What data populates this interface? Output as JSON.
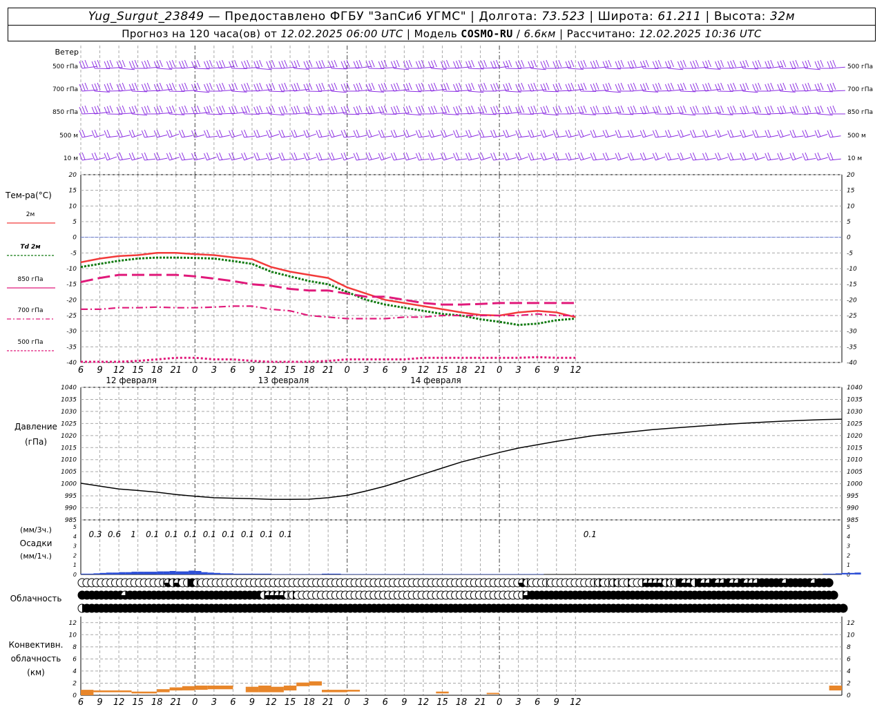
{
  "header": {
    "station": "Yug_Surgut_23849",
    "dash": "—",
    "provided": "Предоставлено ФГБУ \"ЗапСиб УГМС\"",
    "lon_label": "Долгота:",
    "lon": "73.523",
    "lat_label": "Широта:",
    "lat": "61.211",
    "alt_label": "Высота:",
    "alt": "32м",
    "forecast_label": "Прогноз на 120 часа(ов) от",
    "forecast_time": "12.02.2025 06:00 UTC",
    "model_label": "Модель",
    "model": "COSMO-RU",
    "resolution": "6.6км",
    "computed_label": "Рассчитано:",
    "computed_time": "12.02.2025 10:36 UTC",
    "sep": "|"
  },
  "time_axis": {
    "hours": [
      "6",
      "9",
      "12",
      "15",
      "18",
      "21",
      "0",
      "3",
      "6",
      "9",
      "12",
      "15",
      "18",
      "21",
      "0",
      "3",
      "6",
      "9",
      "12",
      "15",
      "18",
      "21",
      "0",
      "3",
      "6",
      "9",
      "12"
    ],
    "dates": [
      {
        "label": "12 февраля",
        "at_index": 2
      },
      {
        "label": "13 февраля",
        "at_index": 10
      },
      {
        "label": "14 февраля",
        "at_index": 18
      }
    ]
  },
  "wind_panel": {
    "title": "Ветер",
    "levels": [
      "500 гПа",
      "700 гПа",
      "850 гПа",
      "500 м",
      "10  м"
    ],
    "right_levels": [
      "500 гПа",
      "700 гПа",
      "850 гПа",
      "500 м",
      "10  м"
    ],
    "barb_color": "#8a2be2"
  },
  "colors": {
    "t2m": "#f23a3a",
    "td2m": "#117a11",
    "t850": "#e0197a",
    "t700": "#e0197a",
    "t500": "#e0197a",
    "zero_line": "#3050e0",
    "precip": "#2d4fd6",
    "convective": "#e8862a",
    "grid": "#a8a8a8"
  },
  "chart_data": [
    {
      "type": "line",
      "panel": "temperature",
      "title": "Тем-ра(°С)",
      "ylim": [
        -40,
        20
      ],
      "yticks": [
        "20",
        "15",
        "10",
        "5",
        "0",
        "-5",
        "-10",
        "-15",
        "-20",
        "-25",
        "-30",
        "-35",
        "-40"
      ],
      "x_hours_from_start": [
        0,
        3,
        6,
        9,
        12,
        15,
        18,
        21,
        24,
        27,
        30,
        33,
        36,
        39,
        42,
        45,
        48,
        51,
        54,
        57,
        60,
        63,
        66,
        69,
        72,
        75,
        78
      ],
      "series": [
        {
          "name": "2м",
          "values": [
            -8,
            -6.8,
            -6,
            -5.7,
            -5,
            -5,
            -5.4,
            -5.7,
            -6.4,
            -7,
            -9.5,
            -11,
            -12,
            -13,
            -16,
            -18,
            -20,
            -21,
            -22,
            -23,
            -24,
            -24.8,
            -25,
            -24,
            -23.5,
            -24,
            -25.5
          ]
        },
        {
          "name": "Td 2м",
          "values": [
            -9.5,
            -8.5,
            -7.5,
            -6.8,
            -6.5,
            -6.5,
            -6.6,
            -6.8,
            -7.6,
            -8.5,
            -11,
            -12.5,
            -14,
            -15,
            -17.5,
            -20,
            -21.5,
            -22.5,
            -23.5,
            -24.5,
            -25,
            -26.2,
            -27,
            -28,
            -27.6,
            -26.5,
            -26
          ]
        },
        {
          "name": "850 гПа",
          "values": [
            -14.3,
            -13,
            -12,
            -12,
            -12,
            -12,
            -12.5,
            -13.2,
            -14,
            -15,
            -15.5,
            -16.5,
            -17,
            -17,
            -18,
            -19,
            -19,
            -20,
            -21,
            -21.5,
            -21.5,
            -21.3,
            -21,
            -21,
            -21,
            -21,
            -21
          ]
        },
        {
          "name": "700 гПа",
          "values": [
            -23,
            -23,
            -22.5,
            -22.5,
            -22.3,
            -22.5,
            -22.5,
            -22.3,
            -22,
            -22,
            -23,
            -23.5,
            -25,
            -25.5,
            -26,
            -26,
            -26,
            -25.5,
            -25.5,
            -25,
            -25,
            -25,
            -25,
            -25,
            -24.5,
            -25,
            -25
          ]
        },
        {
          "name": "500 гПа",
          "values": [
            -41,
            -40.5,
            -40,
            -39.5,
            -39,
            -38.5,
            -38.5,
            -39,
            -39,
            -39.5,
            -40,
            -41,
            -41,
            -39.5,
            -39,
            -39,
            -39,
            -39,
            -38.5,
            -38.5,
            -38.5,
            -38.5,
            -38.5,
            -38.5,
            -38.3,
            -38.5,
            -38.5
          ]
        }
      ]
    },
    {
      "type": "line",
      "panel": "pressure",
      "title": "Давление",
      "unit": "(гПа)",
      "ylim": [
        985,
        1040
      ],
      "yticks": [
        "1040",
        "1035",
        "1030",
        "1025",
        "1020",
        "1015",
        "1010",
        "1005",
        "1000",
        "995",
        "990",
        "985"
      ],
      "x_hours_from_start": [
        0,
        3,
        6,
        9,
        12,
        15,
        18,
        21,
        24,
        27,
        30,
        33,
        36,
        39,
        42,
        45,
        48,
        51,
        54,
        57,
        60,
        63,
        66,
        69,
        72,
        75,
        78,
        81,
        84,
        87,
        90,
        93,
        96,
        99,
        102,
        105,
        108,
        111,
        114,
        117,
        120
      ],
      "values": [
        1000.2,
        999,
        997.8,
        997.2,
        996.5,
        995.5,
        994.8,
        994.2,
        994,
        993.8,
        993.5,
        993.5,
        993.6,
        994.2,
        995.2,
        997,
        999,
        1001.5,
        1004,
        1006.5,
        1009,
        1011,
        1013,
        1014.8,
        1016.2,
        1017.6,
        1018.8,
        1020,
        1020.8,
        1021.6,
        1022.4,
        1023,
        1023.6,
        1024.2,
        1024.7,
        1025.2,
        1025.6,
        1026,
        1026.3,
        1026.6,
        1026.8
      ]
    },
    {
      "type": "bar",
      "panel": "precipitation",
      "title": "Осадки",
      "unit_3h": "(мм/3ч.)",
      "unit_1h": "(мм/1ч.)",
      "ylim": [
        0,
        5
      ],
      "yticks": [
        "5",
        "4",
        "3",
        "2",
        "1",
        "0"
      ],
      "sum_labels_3h": [
        "0.3",
        "0.6",
        "1",
        "0.1",
        "0.1",
        "0.1",
        "0.1",
        "0.1",
        "0.1",
        "0.1",
        "0.1",
        "0.1"
      ],
      "sum_label_indices": [
        0,
        1,
        2,
        3,
        4,
        5,
        6,
        7,
        8,
        9,
        10,
        26
      ],
      "hourly_values": [
        0.1,
        0.1,
        0.15,
        0.2,
        0.25,
        0.25,
        0.3,
        0.3,
        0.35,
        0.35,
        0.35,
        0.35,
        0.4,
        0.4,
        0.45,
        0.4,
        0.4,
        0.5,
        0.45,
        0.3,
        0.25,
        0.2,
        0.15,
        0.15,
        0.1,
        0.1,
        0.1,
        0.1,
        0.1,
        0.1,
        0.05,
        0.05,
        0.05,
        0.05,
        0.05,
        0.05,
        0.05,
        0.05,
        0.1,
        0.1,
        0.1,
        0.05,
        0.05,
        0.05,
        0.05,
        0.05,
        0.05,
        0.05,
        0.05,
        0.05,
        0.05,
        0.05,
        0.05,
        0.05,
        0.05,
        0.05,
        0.05,
        0.05,
        0.05,
        0.05,
        0.05,
        0.05,
        0.05,
        0.05,
        0.05,
        0.05,
        0.05,
        0.05,
        0.05,
        0.05,
        0.05,
        0.05,
        0.05,
        0,
        0,
        0,
        0,
        0,
        0,
        0,
        0,
        0,
        0,
        0,
        0,
        0,
        0,
        0,
        0,
        0,
        0,
        0,
        0,
        0,
        0,
        0,
        0,
        0,
        0,
        0,
        0,
        0,
        0,
        0,
        0,
        0,
        0,
        0,
        0,
        0,
        0,
        0,
        0,
        0,
        0,
        0,
        0,
        0.1,
        0.1,
        0.15,
        0.2,
        0.2,
        0.25
      ]
    },
    {
      "type": "table",
      "panel": "cloudiness",
      "title": "Облачность",
      "rows": [
        [
          0,
          0,
          0,
          0,
          0,
          0,
          0,
          0,
          0,
          0,
          0,
          0,
          0,
          0,
          0,
          0,
          0,
          1,
          3,
          2,
          3,
          0,
          2,
          4,
          1,
          0,
          0,
          0,
          0,
          0,
          0,
          0,
          0,
          0,
          0,
          0,
          0,
          0,
          0,
          0,
          0,
          0,
          0,
          0,
          0,
          0,
          0,
          0,
          0,
          0,
          0,
          0,
          0,
          0,
          0,
          0,
          0,
          0,
          0,
          0,
          0,
          0,
          0,
          0,
          0,
          0,
          0,
          0,
          0,
          0,
          0,
          0,
          0,
          0,
          0,
          0,
          0,
          0,
          0,
          0,
          0,
          0,
          0,
          0,
          0,
          0,
          0,
          0,
          0,
          0,
          0,
          0,
          3,
          1,
          0,
          0,
          0,
          1,
          0,
          0,
          0,
          0,
          0,
          0,
          0,
          0,
          0,
          1,
          2,
          0,
          1,
          2,
          1,
          0,
          2,
          0,
          0,
          2,
          3,
          3,
          3,
          3,
          2,
          1,
          2,
          4,
          3,
          3,
          2,
          4,
          3,
          3,
          4,
          3,
          3,
          4,
          3,
          3,
          4,
          3,
          3,
          3,
          4,
          4,
          4,
          4,
          4,
          3,
          4,
          4,
          4,
          4,
          4,
          3,
          4,
          4,
          4
        ],
        [
          4,
          4,
          4,
          4,
          4,
          4,
          4,
          4,
          4,
          3,
          4,
          4,
          4,
          4,
          4,
          4,
          4,
          4,
          4,
          4,
          4,
          4,
          4,
          4,
          4,
          4,
          4,
          4,
          4,
          4,
          4,
          4,
          4,
          4,
          4,
          4,
          4,
          4,
          2,
          3,
          3,
          3,
          3,
          1,
          2,
          0,
          0,
          0,
          0,
          0,
          0,
          0,
          0,
          0,
          0,
          0,
          0,
          0,
          0,
          0,
          0,
          0,
          0,
          0,
          0,
          0,
          0,
          0,
          0,
          0,
          0,
          0,
          0,
          0,
          0,
          0,
          0,
          0,
          0,
          0,
          0,
          0,
          0,
          0,
          0,
          0,
          0,
          0,
          0,
          0,
          0,
          0,
          2,
          3,
          4,
          4,
          4,
          4,
          4,
          4,
          4,
          4,
          4,
          4,
          4,
          4,
          4,
          4,
          4,
          4,
          4,
          4,
          4,
          4,
          4,
          4,
          4,
          4,
          4,
          4,
          4,
          4,
          4,
          4,
          4,
          4,
          4,
          4,
          4,
          4,
          4,
          4,
          4,
          4,
          4,
          4,
          4,
          4,
          4,
          4,
          4,
          4,
          4,
          4,
          4,
          4,
          4,
          4,
          4,
          4,
          4,
          4,
          4,
          4,
          4,
          4,
          4,
          4
        ],
        [
          2,
          4,
          4,
          4,
          4,
          4,
          4,
          4,
          4,
          4,
          4,
          4,
          4,
          4,
          4,
          4,
          4,
          4,
          4,
          4,
          4,
          4,
          4,
          4,
          4,
          4,
          4,
          4,
          4,
          4,
          4,
          4,
          4,
          4,
          4,
          4,
          4,
          4,
          4,
          4,
          4,
          4,
          4,
          4,
          4,
          4,
          4,
          4,
          4,
          4,
          4,
          4,
          4,
          4,
          4,
          4,
          4,
          4,
          4,
          4,
          4,
          4,
          4,
          4,
          4,
          4,
          4,
          4,
          4,
          4,
          4,
          4,
          4,
          4,
          4,
          4,
          4,
          4,
          4,
          4,
          4,
          4,
          4,
          4,
          4,
          4,
          4,
          4,
          4,
          4,
          4,
          4,
          4,
          4,
          4,
          4,
          4,
          4,
          4,
          4,
          4,
          4,
          4,
          4,
          4,
          4,
          4,
          4,
          4,
          4,
          4,
          4,
          4,
          4,
          4,
          4,
          4,
          4,
          4,
          4,
          4,
          4,
          4,
          4,
          4,
          4,
          4,
          4,
          4,
          4,
          4,
          4,
          4,
          4,
          4,
          4,
          4,
          4,
          4,
          4,
          4,
          4,
          4,
          4,
          4,
          4,
          4,
          4,
          4,
          4,
          4,
          4,
          4,
          4,
          4,
          4,
          4,
          4,
          4,
          4
        ]
      ]
    },
    {
      "type": "bar",
      "panel": "convective",
      "title": "Конвективн.",
      "title2": "облачность",
      "unit": "(км)",
      "ylim": [
        0,
        13
      ],
      "yticks": [
        "12",
        "10",
        "8",
        "6",
        "4",
        "2",
        "0"
      ],
      "segments": [
        {
          "from_h": 0,
          "to_h": 3,
          "bottom": 0,
          "top": 0.9
        },
        {
          "from_h": 3,
          "to_h": 12,
          "bottom": 0.5,
          "top": 0.8
        },
        {
          "from_h": 12,
          "to_h": 18,
          "bottom": 0.3,
          "top": 0.6
        },
        {
          "from_h": 18,
          "to_h": 21,
          "bottom": 0.5,
          "top": 1
        },
        {
          "from_h": 21,
          "to_h": 24,
          "bottom": 0.8,
          "top": 1.3
        },
        {
          "from_h": 24,
          "to_h": 27,
          "bottom": 0.8,
          "top": 1.5
        },
        {
          "from_h": 27,
          "to_h": 30,
          "bottom": 0.9,
          "top": 1.6
        },
        {
          "from_h": 30,
          "to_h": 36,
          "bottom": 1,
          "top": 1.6
        },
        {
          "from_h": 39,
          "to_h": 42,
          "bottom": 0.5,
          "top": 1.4
        },
        {
          "from_h": 42,
          "to_h": 45,
          "bottom": 0.5,
          "top": 1.6
        },
        {
          "from_h": 45,
          "to_h": 48,
          "bottom": 0.5,
          "top": 1.4
        },
        {
          "from_h": 48,
          "to_h": 51,
          "bottom": 0.8,
          "top": 1.6
        },
        {
          "from_h": 51,
          "to_h": 54,
          "bottom": 1.5,
          "top": 2.1
        },
        {
          "from_h": 54,
          "to_h": 57,
          "bottom": 1.6,
          "top": 2.3
        },
        {
          "from_h": 57,
          "to_h": 63,
          "bottom": 0.5,
          "top": 0.9
        },
        {
          "from_h": 63,
          "to_h": 66,
          "bottom": 0.6,
          "top": 0.9
        },
        {
          "from_h": 84,
          "to_h": 87,
          "bottom": 0.3,
          "top": 0.6
        },
        {
          "from_h": 96,
          "to_h": 99,
          "bottom": 0.2,
          "top": 0.4
        },
        {
          "from_h": 177,
          "to_h": 180,
          "bottom": 0.8,
          "top": 1.6
        }
      ]
    }
  ]
}
